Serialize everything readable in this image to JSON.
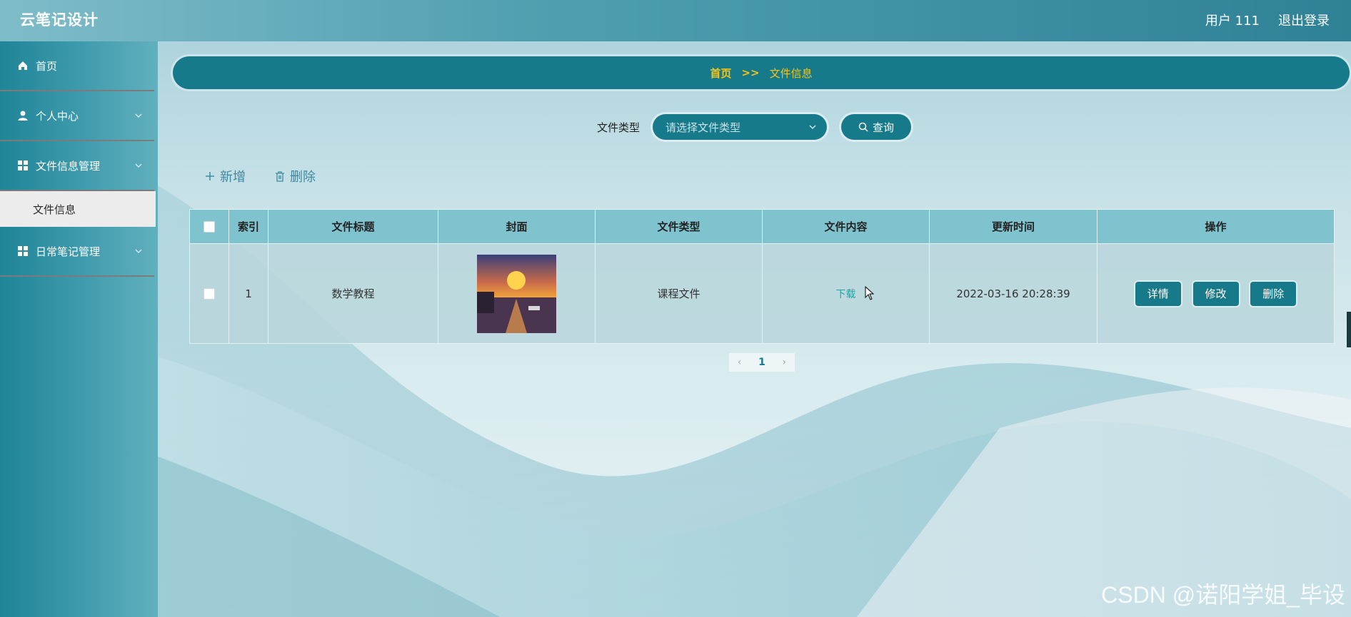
{
  "header": {
    "title": "云笔记设计",
    "user_label": "用户 111",
    "logout_label": "退出登录"
  },
  "sidebar": {
    "items": [
      {
        "label": "首页",
        "icon": "home-icon"
      },
      {
        "label": "个人中心",
        "icon": "user-icon"
      },
      {
        "label": "文件信息管理",
        "icon": "grid-icon"
      },
      {
        "label": "文件信息"
      },
      {
        "label": "日常笔记管理",
        "icon": "grid-icon"
      }
    ]
  },
  "breadcrumb": {
    "home": "首页",
    "separator": ">>",
    "current": "文件信息"
  },
  "search": {
    "label": "文件类型",
    "placeholder": "请选择文件类型",
    "button_label": "查询"
  },
  "actions": {
    "add_label": "新增",
    "delete_label": "删除"
  },
  "table": {
    "columns": [
      "索引",
      "文件标题",
      "封面",
      "文件类型",
      "文件内容",
      "更新时间",
      "操作"
    ],
    "rows": [
      {
        "index": "1",
        "title": "数学教程",
        "type": "课程文件",
        "content_link": "下载",
        "updated": "2022-03-16 20:28:39",
        "ops": [
          "详情",
          "修改",
          "删除"
        ]
      }
    ]
  },
  "pagination": {
    "current": "1"
  },
  "watermark": "CSDN @诺阳学姐_毕设",
  "colors": {
    "primary": "#177a8b",
    "accent": "#f5c518",
    "link": "#19a7a5"
  }
}
